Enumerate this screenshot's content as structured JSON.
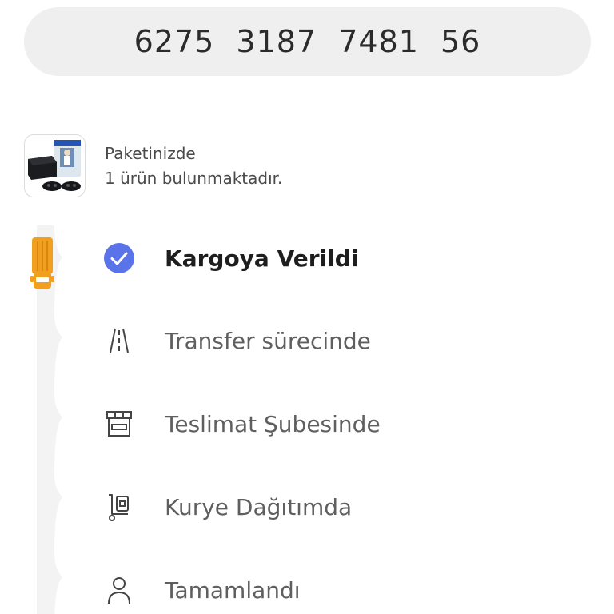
{
  "tracking": {
    "number": "6275  3187  7481  56"
  },
  "package": {
    "line1": "Paketinizde",
    "line2": "1 ürün bulunmaktadır."
  },
  "steps": [
    {
      "label": "Kargoya Verildi",
      "icon": "check-circle-icon",
      "status": "done"
    },
    {
      "label": "Transfer sürecinde",
      "icon": "road-icon",
      "status": "pending"
    },
    {
      "label": "Teslimat Şubesinde",
      "icon": "store-icon",
      "status": "pending"
    },
    {
      "label": "Kurye Dağıtımda",
      "icon": "hand-truck-icon",
      "status": "pending"
    },
    {
      "label": "Tamamlandı",
      "icon": "person-icon",
      "status": "pending"
    }
  ],
  "colors": {
    "accent": "#5b73e8",
    "truck": "#f0a01e",
    "pill_bg": "#efefef",
    "rail": "#f3f3f3"
  }
}
